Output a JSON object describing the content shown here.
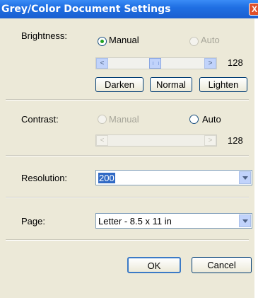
{
  "window": {
    "title": "Grey/Color Document Settings",
    "close_glyph": "X"
  },
  "brightness": {
    "label": "Brightness:",
    "manual_label": "Manual",
    "auto_label": "Auto",
    "selected": "manual",
    "value": "128",
    "buttons": {
      "darken": "Darken",
      "normal": "Normal",
      "lighten": "Lighten"
    },
    "left_arrow": "<",
    "right_arrow": ">"
  },
  "contrast": {
    "label": "Contrast:",
    "manual_label": "Manual",
    "auto_label": "Auto",
    "selected": "auto",
    "value": "128",
    "left_arrow": "<",
    "right_arrow": ">"
  },
  "resolution": {
    "label": "Resolution:",
    "value": "200"
  },
  "page": {
    "label": "Page:",
    "value": "Letter - 8.5 x 11 in"
  },
  "actions": {
    "ok": "OK",
    "cancel": "Cancel"
  },
  "colors": {
    "title_bar": "#1f6fe3",
    "dialog_bg": "#ece9d8",
    "close_button": "#e0502a"
  }
}
